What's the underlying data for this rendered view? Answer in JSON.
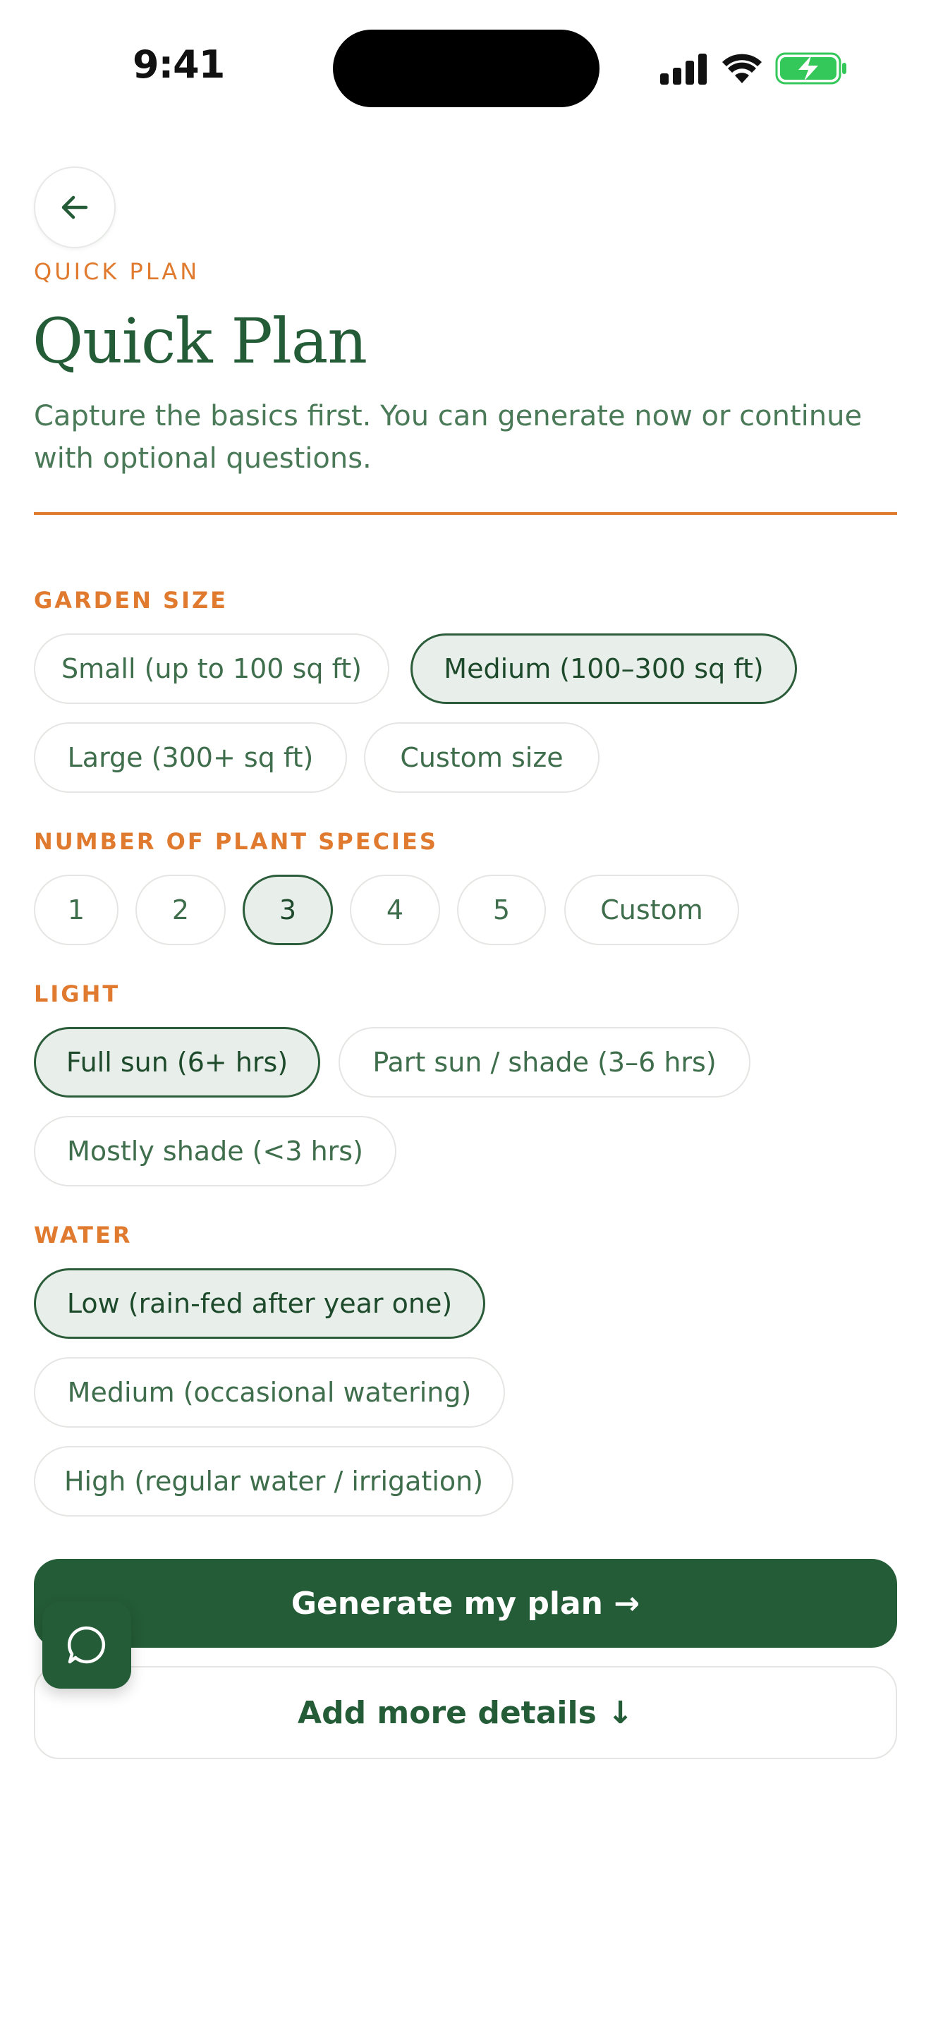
{
  "status_bar": {
    "time": "9:41",
    "icons": [
      "cellular-signal-icon",
      "wifi-icon",
      "battery-charging-icon"
    ]
  },
  "header": {
    "back_icon": "arrow-left-icon",
    "eyebrow": "QUICK PLAN",
    "title": "Quick Plan",
    "subtitle": "Capture the basics first. You can generate now or continue with optional questions."
  },
  "sections": {
    "garden_size": {
      "label": "GARDEN SIZE",
      "options": [
        "Small (up to 100 sq ft)",
        "Medium (100–300 sq ft)",
        "Large (300+ sq ft)",
        "Custom size"
      ],
      "selected": "Medium (100–300 sq ft)"
    },
    "species": {
      "label": "NUMBER OF PLANT SPECIES",
      "options": [
        "1",
        "2",
        "3",
        "4",
        "5",
        "Custom"
      ],
      "selected": "3"
    },
    "light": {
      "label": "LIGHT",
      "options": [
        "Full sun (6+ hrs)",
        "Part sun / shade (3–6 hrs)",
        "Mostly shade (<3 hrs)"
      ],
      "selected": "Full sun (6+ hrs)"
    },
    "water": {
      "label": "WATER",
      "options": [
        "Low (rain-fed after year one)",
        "Medium (occasional watering)",
        "High (regular water / irrigation)"
      ],
      "selected": "Low (rain-fed after year one)"
    }
  },
  "actions": {
    "generate_label": "Generate my plan →",
    "more_label": "Add more details ↓",
    "chat_icon": "chat-bubble-icon"
  },
  "colors": {
    "accent": "#e07a2e",
    "primary": "#245c37",
    "chip_selected_bg": "#e8eee9",
    "battery_green": "#34c759"
  }
}
